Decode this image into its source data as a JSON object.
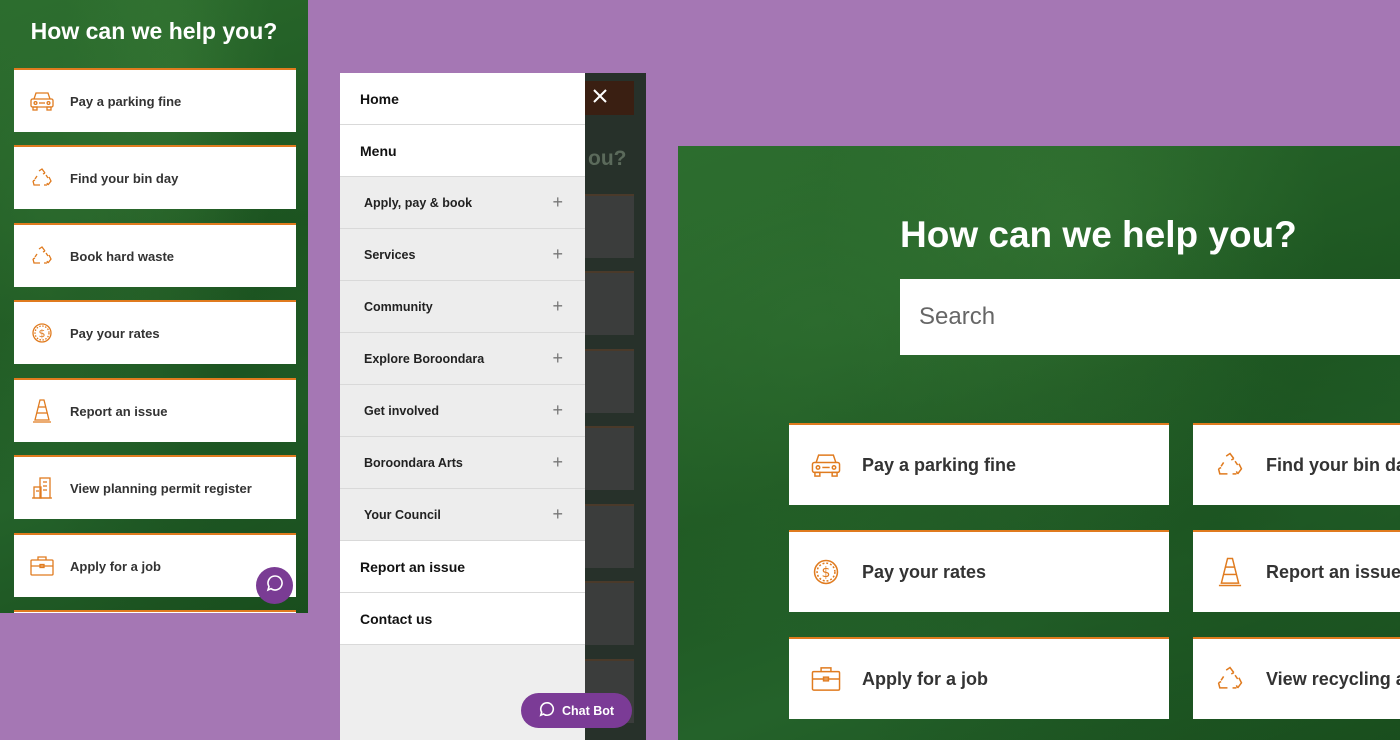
{
  "mobile": {
    "title": "How can we help you?",
    "cards": [
      {
        "label": "Pay a parking fine",
        "icon": "car-icon"
      },
      {
        "label": "Find your bin day",
        "icon": "recycle-icon"
      },
      {
        "label": "Book hard waste",
        "icon": "recycle-icon"
      },
      {
        "label": "Pay your rates",
        "icon": "dollar-coin-icon"
      },
      {
        "label": "Report an issue",
        "icon": "traffic-cone-icon"
      },
      {
        "label": "View planning permit register",
        "icon": "building-icon"
      },
      {
        "label": "Apply for a job",
        "icon": "briefcase-icon"
      }
    ],
    "chat_icon": "chat-bubble-icon"
  },
  "menu": {
    "close_icon": "close-icon",
    "overlay_heading_fragment": "ou?",
    "items": [
      {
        "label": "Home"
      },
      {
        "label": "Menu"
      },
      {
        "label": "Apply, pay & book"
      },
      {
        "label": "Services"
      },
      {
        "label": "Community"
      },
      {
        "label": "Explore Boroondara"
      },
      {
        "label": "Get involved"
      },
      {
        "label": "Boroondara Arts"
      },
      {
        "label": "Your Council"
      },
      {
        "label": "Report an issue"
      },
      {
        "label": "Contact us"
      }
    ],
    "expand_symbol": "+",
    "chatbot_label": "Chat Bot"
  },
  "desktop": {
    "title": "How can we help you?",
    "search_placeholder": "Search",
    "cards": [
      {
        "label": "Pay a parking fine",
        "icon": "car-icon"
      },
      {
        "label": "Find your bin day",
        "icon": "recycle-icon"
      },
      {
        "label": "Pay your rates",
        "icon": "dollar-coin-icon"
      },
      {
        "label": "Report an issue",
        "icon": "traffic-cone-icon"
      },
      {
        "label": "Apply for a job",
        "icon": "briefcase-icon"
      },
      {
        "label": "View recycling a",
        "icon": "recycle-icon"
      }
    ]
  },
  "colors": {
    "background": "#a577b4",
    "accent_orange": "#e07b1f",
    "chat_purple": "#7b3b96",
    "leaf_green": "#1f5a24"
  }
}
